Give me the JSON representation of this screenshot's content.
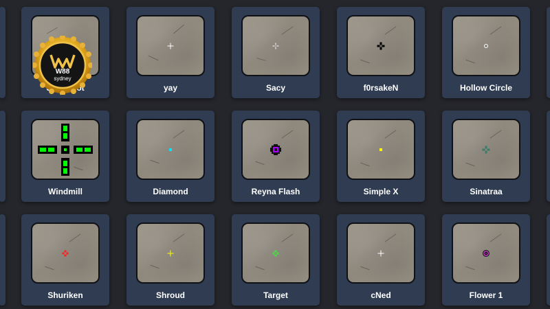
{
  "colors": {
    "background": "#25262b",
    "card": "#2f3c52",
    "label": "#ffffff"
  },
  "badge": {
    "brand": "W88",
    "city": "sydney",
    "icon": "gold-seal-logo"
  },
  "cards": [
    {
      "name": "Small Dot",
      "crosshair": "none",
      "color": "#ffffff"
    },
    {
      "name": "yay",
      "crosshair": "plus-small",
      "color": "#ffffff"
    },
    {
      "name": "Sacy",
      "crosshair": "dot-cross",
      "color": "#ffffff"
    },
    {
      "name": "f0rsakeN",
      "crosshair": "dot-cross",
      "color": "#000000"
    },
    {
      "name": "Hollow Circle",
      "crosshair": "ring",
      "color": "#ffffff"
    },
    {
      "name": "Windmill",
      "crosshair": "windmill",
      "color": "#00ff00"
    },
    {
      "name": "Diamond",
      "crosshair": "dot",
      "color": "#00e5ff"
    },
    {
      "name": "Reyna Flash",
      "crosshair": "reyna-orb",
      "color": "#b000ff"
    },
    {
      "name": "Simple X",
      "crosshair": "dot",
      "color": "#ffff00"
    },
    {
      "name": "Sinatraa",
      "crosshair": "dot-cross",
      "color": "#3d7a6a"
    },
    {
      "name": "Shuriken",
      "crosshair": "dot-cross",
      "color": "#ff1f1f"
    },
    {
      "name": "Shroud",
      "crosshair": "plus-small",
      "color": "#ffff00"
    },
    {
      "name": "Target",
      "crosshair": "dot-cross",
      "color": "#44dd44"
    },
    {
      "name": "cNed",
      "crosshair": "plus-small",
      "color": "#ffffff"
    },
    {
      "name": "Flower 1",
      "crosshair": "flower",
      "color": "#d43bd4"
    }
  ]
}
